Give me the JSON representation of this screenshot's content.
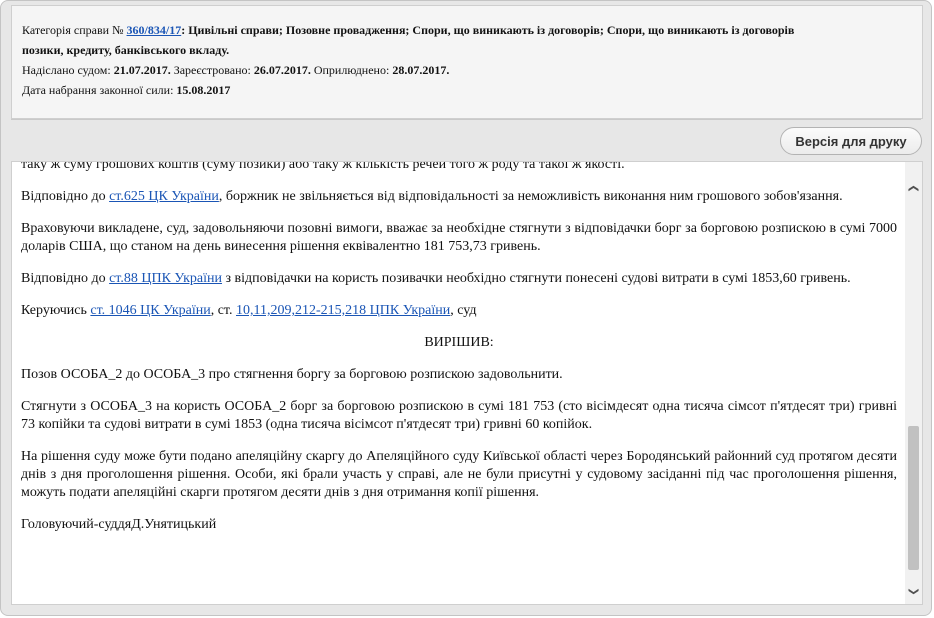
{
  "header": {
    "category_label": "Категорія справи №",
    "case_number": "360/834/17",
    "category_text": ": Цивільні справи; Позовне провадження; Спори, що виникають із договорів; Спори, що виникають із договорів",
    "category_text_2": "позики, кредиту, банківського вкладу.",
    "sent_label": "Надіслано судом:",
    "sent_date": "21.07.2017.",
    "registered_label": "Зареєстровано:",
    "registered_date": "26.07.2017.",
    "published_label": "Оприлюднено:",
    "published_date": "28.07.2017.",
    "effective_label": "Дата набрання законної сили:",
    "effective_date": "15.08.2017"
  },
  "toolbar": {
    "print_label": "Версія для друку"
  },
  "document": {
    "p0": "таку ж суму грошових коштів (суму позики) або таку ж кількість речей того ж роду та такої ж якості.",
    "p1_a": "Відповідно до ",
    "p1_link": "ст.625 ЦК України",
    "p1_b": ", боржник не звільняється від відповідальності за неможливість виконання ним грошового зобов'язання.",
    "p2": "Враховуючи викладене, суд, задовольняючи позовні вимоги, вважає за необхідне стягнути з відповідачки борг за борговою розпискою в сумі 7000 доларів США, що станом на день винесення рішення еквівалентно 181 753,73 гривень.",
    "p3_a": "Відповідно до ",
    "p3_link": "ст.88 ЦПК України",
    "p3_b": " з відповідачки на користь позивачки необхідно стягнути понесені судові витрати в сумі 1853,60 гривень.",
    "p4_a": "Керуючись ",
    "p4_link1": "ст. 1046 ЦК України",
    "p4_b": ", ст. ",
    "p4_link2": "10,11,209,212-215,218 ЦПК України",
    "p4_c": ", суд",
    "p5": "ВИРІШИВ:",
    "p6": "Позов ОСОБА_2 до ОСОБА_3 про стягнення боргу за борговою розпискою задовольнити.",
    "p7": "Стягнути з ОСОБА_3 на користь ОСОБА_2 борг за борговою розпискою в сумі 181 753 (сто вісімдесят одна тисяча сімсот п'ятдесят три) гривні 73 копійки та судові витрати в сумі 1853 (одна тисяча вісімсот п'ятдесят три) гривні 60 копійок.",
    "p8": "На рішення суду може бути подано апеляційну скаргу до Апеляційного суду Київської області через Бородянський районний суд протягом десяти днів з дня проголошення рішення. Особи, які брали участь у справі, але не були присутні у судовому засіданні під час проголошення рішення, можуть подати апеляційні скарги протягом десяти днів з дня отримання копії рішення.",
    "p9": "Головуючий-суддяД.Унятицький"
  },
  "scrollbar": {
    "up_icon": "chevron-up-icon",
    "down_icon": "chevron-down-icon"
  }
}
